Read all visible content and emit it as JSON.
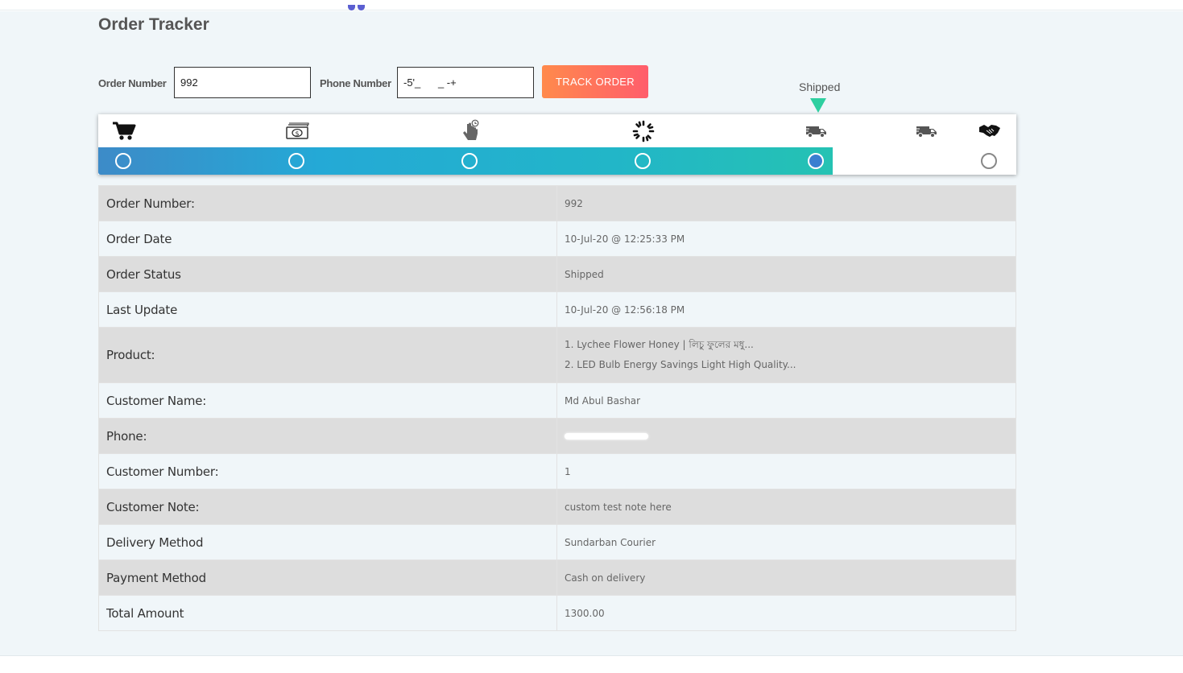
{
  "header": {
    "title": "Order Tracker"
  },
  "search": {
    "order_label": "Order Number",
    "order_value": "992",
    "phone_label": "Phone Number",
    "phone_value": "-5'_      _ -+",
    "button_label": "TRACK ORDER"
  },
  "tracker": {
    "current_label": "Shipped",
    "steps": [
      {
        "icon": "cart-icon",
        "state": "done"
      },
      {
        "icon": "cash-icon",
        "state": "done"
      },
      {
        "icon": "hand-pointer-icon",
        "state": "done"
      },
      {
        "icon": "spinner-icon",
        "state": "done"
      },
      {
        "icon": "truck-icon",
        "state": "current"
      },
      {
        "icon": "truck-icon",
        "state": "pending"
      },
      {
        "icon": "handshake-icon",
        "state": "pending"
      }
    ],
    "progress_fraction": 0.8,
    "colors": {
      "arrow": "#2ecfa0",
      "bar_start": "#3d8bc8",
      "bar_end": "#25c2b3",
      "current_dot": "#3a7fd0"
    }
  },
  "details": {
    "rows": [
      {
        "label": "Order Number:",
        "value": "992"
      },
      {
        "label": "Order Date",
        "value": "10-Jul-20 @ 12:25:33 PM"
      },
      {
        "label": "Order Status",
        "value": "Shipped"
      },
      {
        "label": "Last Update",
        "value": "10-Jul-20 @ 12:56:18 PM"
      },
      {
        "label": "Product:",
        "products": [
          "1. Lychee Flower Honey | লিচু ফুলের মধু...",
          "2. LED Bulb Energy Savings Light High Quality..."
        ]
      },
      {
        "label": "Customer Name:",
        "value": "Md Abul Bashar"
      },
      {
        "label": "Phone:",
        "redacted": true
      },
      {
        "label": "Customer Number:",
        "value": "1"
      },
      {
        "label": "Customer Note:",
        "value": "custom test note here"
      },
      {
        "label": "Delivery Method",
        "value": "Sundarban Courier"
      },
      {
        "label": "Payment Method",
        "value": "Cash on delivery"
      },
      {
        "label": "Total Amount",
        "value": "1300.00"
      }
    ]
  },
  "colors": {
    "button_start": "#ff8a4c",
    "button_end": "#ff5d6c",
    "page_bg": "#f0f6f9",
    "row_alt": "#dddddd"
  }
}
